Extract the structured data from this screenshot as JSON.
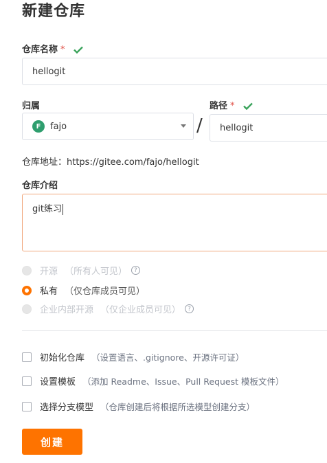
{
  "page": {
    "title": "新建仓库"
  },
  "repo_name": {
    "label": "仓库名称",
    "required_mark": "*",
    "value": "hellogit"
  },
  "owner": {
    "label": "归属",
    "avatar_letter": "F",
    "value": "fajo"
  },
  "separator": "/",
  "path": {
    "label": "路径",
    "required_mark": "*",
    "value": "hellogit"
  },
  "address": {
    "text": "仓库地址：https://gitee.com/fajo/hellogit"
  },
  "description": {
    "label": "仓库介绍",
    "value": "git练习"
  },
  "visibility": {
    "options": [
      {
        "label": "开源",
        "hint": "（所有人可见）",
        "checked": false,
        "disabled": true
      },
      {
        "label": "私有",
        "hint": "（仅仓库成员可见）",
        "checked": true,
        "disabled": false
      },
      {
        "label": "企业内部开源",
        "hint": "（仅企业成员可见）",
        "checked": false,
        "disabled": true
      }
    ],
    "help_glyph": "?"
  },
  "options": [
    {
      "label": "初始化仓库",
      "hint": "（设置语言、.gitignore、开源许可证）",
      "checked": false
    },
    {
      "label": "设置模板",
      "hint": "（添加 Readme、Issue、Pull Request 模板文件）",
      "checked": false
    },
    {
      "label": "选择分支模型",
      "hint": "（仓库创建后将根据所选模型创建分支）",
      "checked": false
    }
  ],
  "create_button": {
    "label": "创建"
  },
  "colors": {
    "accent": "#fe7300",
    "success": "#3aa35b",
    "required": "#e04e44"
  }
}
